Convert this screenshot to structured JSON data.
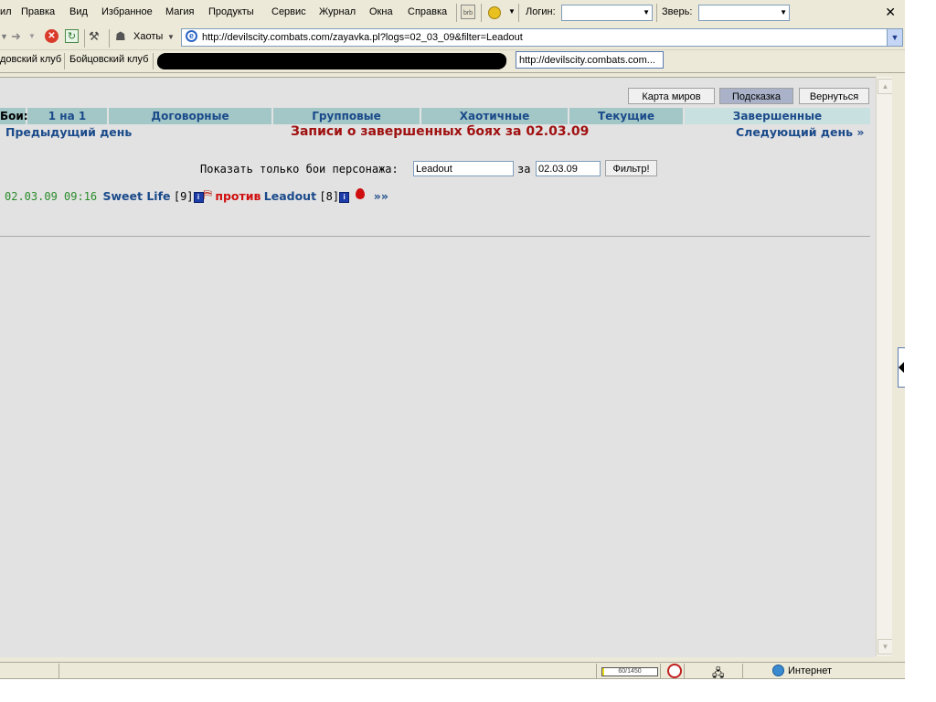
{
  "menubar": {
    "items": [
      "ил",
      "Правка",
      "Вид",
      "Избранное",
      "Магия",
      "Продукты",
      "Сервис",
      "Журнал",
      "Окна",
      "Справка"
    ],
    "brb_label": "brb",
    "login_label": "Логин:",
    "beast_label": "Зверь:",
    "close_glyph": "✕"
  },
  "toolbar": {
    "chaos_label": "Хаоты",
    "address": "http://devilscity.combats.com/zayavka.pl?logs=02_03_09&filter=Leadout"
  },
  "links": {
    "tabs": [
      "довский клуб",
      "Бойцовский клуб"
    ],
    "tooltip": "http://devilscity.combats.com..."
  },
  "page": {
    "buttons": {
      "map": "Карта миров",
      "hint": "Подсказка",
      "back": "Вернуться"
    },
    "fights_label": "Бои:",
    "nav_tabs": [
      "1 на 1",
      "Договорные",
      "Групповые",
      "Хаотичные",
      "Текущие",
      "Завершенные"
    ],
    "prev_day": "Предыдущий день",
    "title": "Записи о завершенных боях за 02.03.09",
    "next_day": "Следующий день »",
    "filter": {
      "label": "Показать только бои персонажа:",
      "name_value": "Leadout",
      "for_label": "за",
      "date_value": "02.03.09",
      "submit": "Фильтр!"
    },
    "log": {
      "time": "02.03.09 09:16",
      "player1": "Sweet Life",
      "level1": "[9]",
      "vs": "против",
      "player2": "Leadout",
      "level2": "[8]",
      "more": "»»"
    }
  },
  "status": {
    "progress_text": "60/1450",
    "progress_value": 0.04,
    "zone": "Интернет"
  },
  "colors": {
    "nav_bg": "#a3c7c7",
    "link_blue": "#1a4a8a",
    "title_red": "#a01010",
    "time_green": "#2a8a2a",
    "vs_red": "#d01010"
  }
}
